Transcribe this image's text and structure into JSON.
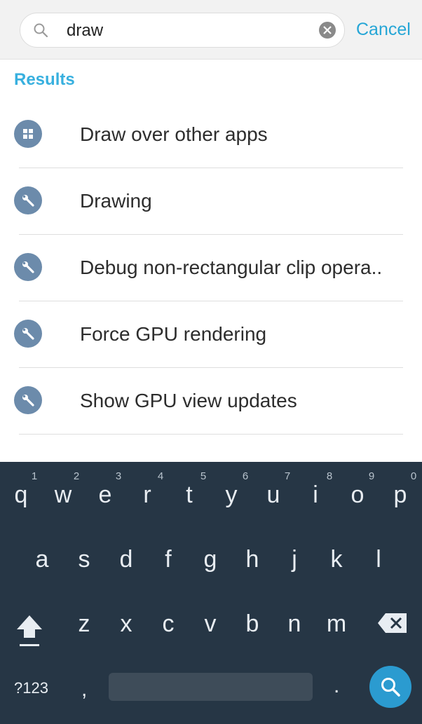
{
  "search": {
    "query": "draw",
    "icon": "search-icon",
    "clear_icon": "clear-icon",
    "cancel_label": "Cancel"
  },
  "results": {
    "heading": "Results",
    "items": [
      {
        "label": "Draw over other apps",
        "icon": "apps-icon"
      },
      {
        "label": "Drawing",
        "icon": "wrench-icon"
      },
      {
        "label": "Debug non-rectangular clip opera..",
        "icon": "wrench-icon"
      },
      {
        "label": "Force GPU rendering",
        "icon": "wrench-icon"
      },
      {
        "label": "Show GPU view updates",
        "icon": "wrench-icon"
      }
    ]
  },
  "keyboard": {
    "row1": [
      "q",
      "w",
      "e",
      "r",
      "t",
      "y",
      "u",
      "i",
      "o",
      "p"
    ],
    "row1_hints": [
      "1",
      "2",
      "3",
      "4",
      "5",
      "6",
      "7",
      "8",
      "9",
      "0"
    ],
    "row2": [
      "a",
      "s",
      "d",
      "f",
      "g",
      "h",
      "j",
      "k",
      "l"
    ],
    "row3": [
      "z",
      "x",
      "c",
      "v",
      "b",
      "n",
      "m"
    ],
    "symbols_label": "?123",
    "comma": ",",
    "period": ".",
    "shift_icon": "shift-icon",
    "backspace_icon": "backspace-icon",
    "enter_icon": "search-icon"
  },
  "colors": {
    "accent": "#26a6d6",
    "results_heading": "#38b0df",
    "icon_bg": "#6c8bab",
    "keyboard_bg": "#263645",
    "enter_key": "#2b9bd0"
  }
}
